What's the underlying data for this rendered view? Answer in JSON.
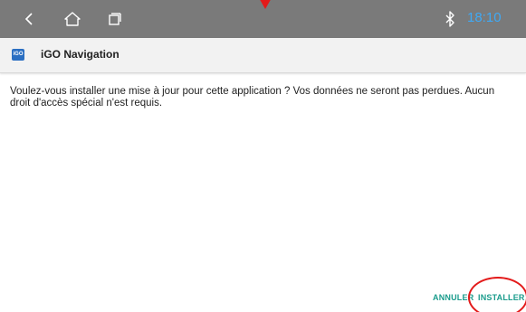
{
  "status_bar": {
    "time": "18:10",
    "icons": {
      "back": "back-icon",
      "home": "home-icon",
      "recent": "recent-apps-icon",
      "bluetooth": "bluetooth-icon"
    },
    "colors": {
      "background": "#7a7a7a",
      "clock": "#3fa9f5"
    }
  },
  "header": {
    "app_title": "iGO Navigation",
    "icon": "igo-app-icon",
    "icon_text": "iGO"
  },
  "dialog": {
    "message": "Voulez-vous installer une mise à jour pour cette application ? Vos données ne seront pas perdues. Aucun droit d'accès spécial n'est requis.",
    "cancel_label": "ANNULER",
    "install_label": "INSTALLER",
    "accent_color": "#1a9c8c"
  },
  "annotations": {
    "highlight_color": "#e31a1a"
  }
}
